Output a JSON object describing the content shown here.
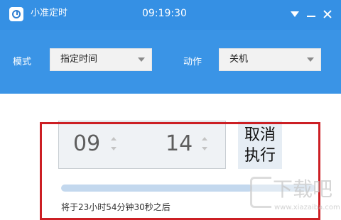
{
  "titlebar": {
    "app_name": "小准定时",
    "clock": "09:19:30",
    "icons": {
      "app": "clock-app-icon",
      "menu": "dropdown-menu-icon",
      "minimize": "minimize-icon",
      "close": "close-icon"
    }
  },
  "toolbar": {
    "mode_label": "模式",
    "mode_value": "指定时间",
    "action_label": "动作",
    "action_value": "关机"
  },
  "timer": {
    "hours": "09",
    "minutes": "14",
    "cancel_label": "取消执行",
    "progress": 0.75,
    "countdown_text": "将于23小时54分钟30秒之后"
  },
  "watermark": {
    "text": "下载吧",
    "url": "www.xiazaiba.com"
  },
  "colors": {
    "titlebar": "#3590e4",
    "toolbar": "#3a94e6",
    "highlight": "#cc1f24",
    "progress_fill": "#c3d8ee"
  }
}
